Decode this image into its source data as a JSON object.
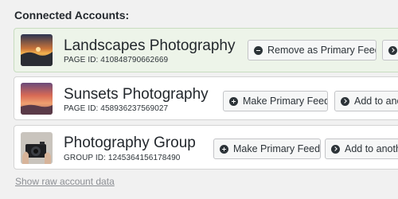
{
  "heading": "Connected Accounts:",
  "accounts": [
    {
      "name": "Landscapes Photography",
      "id_label": "PAGE ID: 410848790662669",
      "is_primary": true,
      "buttons": [
        {
          "label": "Remove as Primary Feed",
          "icon": "minus-circle-icon"
        },
        {
          "label": "",
          "icon": "chevron-right-circle-icon"
        }
      ]
    },
    {
      "name": "Sunsets Photography",
      "id_label": "PAGE ID: 458936237569027",
      "is_primary": false,
      "buttons": [
        {
          "label": "Make Primary Feed",
          "icon": "plus-circle-icon"
        },
        {
          "label": "Add to ano",
          "icon": "chevron-right-circle-icon"
        }
      ]
    },
    {
      "name": "Photography Group",
      "id_label": "GROUP ID: 1245364156178490",
      "is_primary": false,
      "buttons": [
        {
          "label": "Make Primary Feed",
          "icon": "plus-circle-icon"
        },
        {
          "label": "Add to anoth",
          "icon": "chevron-right-circle-icon"
        }
      ]
    }
  ],
  "raw_data_link": "Show raw account data"
}
